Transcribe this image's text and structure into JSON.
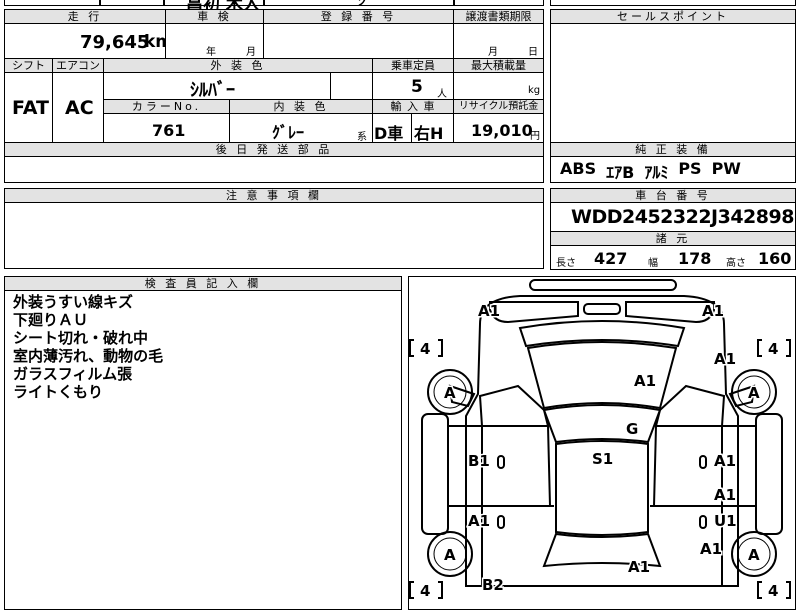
{
  "top_strip": {
    "cut_text": "昌初 木入",
    "cut_text2": "ゾ"
  },
  "mileage": {
    "header": "走 行",
    "value": "79,645",
    "unit": "km"
  },
  "inspection": {
    "header": "車 検",
    "year_unit": "年",
    "month_unit": "月"
  },
  "registration": {
    "header": "登 録 番 号",
    "value": ""
  },
  "transfer_deadline": {
    "header": "譲渡書類期限",
    "month_unit": "月",
    "day_unit": "日"
  },
  "shift": {
    "header": "シフト",
    "value": "FAT"
  },
  "aircon": {
    "header": "エアコン",
    "value": "AC"
  },
  "exterior_color": {
    "header": "外 装 色",
    "value": "ｼﾙﾊﾞｰ"
  },
  "color_no": {
    "header": "カラーNo.",
    "value": "761"
  },
  "interior_color": {
    "header": "内 装 色",
    "value": "ｸﾞﾚｰ",
    "suffix": "系"
  },
  "capacity": {
    "header": "乗車定員",
    "value": "5",
    "unit": "人"
  },
  "max_load": {
    "header": "最大積載量",
    "unit": "kg"
  },
  "import": {
    "header": "輸 入 車",
    "value1": "D車",
    "value2": "右H"
  },
  "recycle": {
    "header": "リサイクル預託金",
    "value": "19,010",
    "unit": "円"
  },
  "delivery_parts": {
    "header": "後 日 発 送 部 品"
  },
  "sales_points": {
    "header": "セールスポイント"
  },
  "equipment": {
    "header": "純 正 装 備",
    "items": [
      "ABS",
      "ｴｱB",
      "ｱﾙﾐ",
      "PS",
      "PW"
    ]
  },
  "notes": {
    "header": "注 意 事 項 欄"
  },
  "chassis": {
    "header": "車 台 番 号",
    "value": "WDD2452322J342898"
  },
  "specs": {
    "header": "諸 元",
    "length_label": "長さ",
    "length_value": "427",
    "width_label": "幅",
    "width_value": "178",
    "height_label": "高さ",
    "height_value": "160"
  },
  "inspector": {
    "header": "検 査 員 記 入 欄",
    "lines": [
      "外装うすい線キズ",
      "下廻りＡＵ",
      "シート切れ・破れ中",
      "室内薄汚れ、動物の毛",
      "ガラスフィルム張",
      "ライトくもり"
    ]
  },
  "diagram": {
    "tire_tread": "4",
    "wheel": "A",
    "marks": {
      "front_left": "A1",
      "front_right": "A1",
      "right_front_fender": "A1",
      "hood": "A1",
      "windshield": "G",
      "roof": "S1",
      "left_front_door": "B1",
      "right_front_door": "A1",
      "right_rear_door_upper": "A1",
      "left_rear_door": "A1",
      "right_rear_door": "U1",
      "right_rear_fender": "A1",
      "trunk": "A1",
      "left_rear": "B2"
    }
  }
}
